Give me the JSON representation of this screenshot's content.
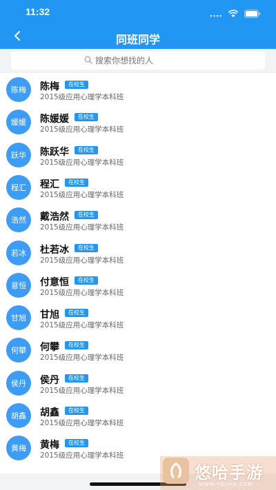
{
  "status_bar": {
    "time": "11:32",
    "icons": [
      "signal-dots-icon",
      "wifi-icon",
      "battery-icon"
    ]
  },
  "nav": {
    "title": "同班同学",
    "back_icon": "chevron-left-icon"
  },
  "search": {
    "placeholder": "搜索你想找的人",
    "icon": "search-icon"
  },
  "students": [
    {
      "avatar": "陈梅",
      "name": "陈梅",
      "badge": "在校生",
      "class": "2015级应用心理学本科班"
    },
    {
      "avatar": "媛媛",
      "name": "陈媛媛",
      "badge": "在校生",
      "class": "2015级应用心理学本科班"
    },
    {
      "avatar": "跃华",
      "name": "陈跃华",
      "badge": "在校生",
      "class": "2015级应用心理学本科班"
    },
    {
      "avatar": "程汇",
      "name": "程汇",
      "badge": "在校生",
      "class": "2015级应用心理学本科班"
    },
    {
      "avatar": "浩然",
      "name": "戴浩然",
      "badge": "在校生",
      "class": "2015级应用心理学本科班"
    },
    {
      "avatar": "若冰",
      "name": "杜若冰",
      "badge": "在校生",
      "class": "2015级应用心理学本科班"
    },
    {
      "avatar": "意恒",
      "name": "付意恒",
      "badge": "在校生",
      "class": "2015级应用心理学本科班"
    },
    {
      "avatar": "甘旭",
      "name": "甘旭",
      "badge": "在校生",
      "class": "2015级应用心理学本科班"
    },
    {
      "avatar": "何攀",
      "name": "何攀",
      "badge": "在校生",
      "class": "2015级应用心理学本科班"
    },
    {
      "avatar": "侯丹",
      "name": "侯丹",
      "badge": "在校生",
      "class": "2015级应用心理学本科班"
    },
    {
      "avatar": "胡鑫",
      "name": "胡鑫",
      "badge": "在校生",
      "class": "2015级应用心理学本科班"
    },
    {
      "avatar": "黄梅",
      "name": "黄梅",
      "badge": "在校生",
      "class": "2015级应用心理学本科班"
    }
  ],
  "watermark": {
    "text": "悠哈手游",
    "url": "WWW.YOUHA.COM"
  },
  "colors": {
    "primary": "#2196f3",
    "avatar": "#3d9cf5",
    "background": "#f2f3f5"
  }
}
